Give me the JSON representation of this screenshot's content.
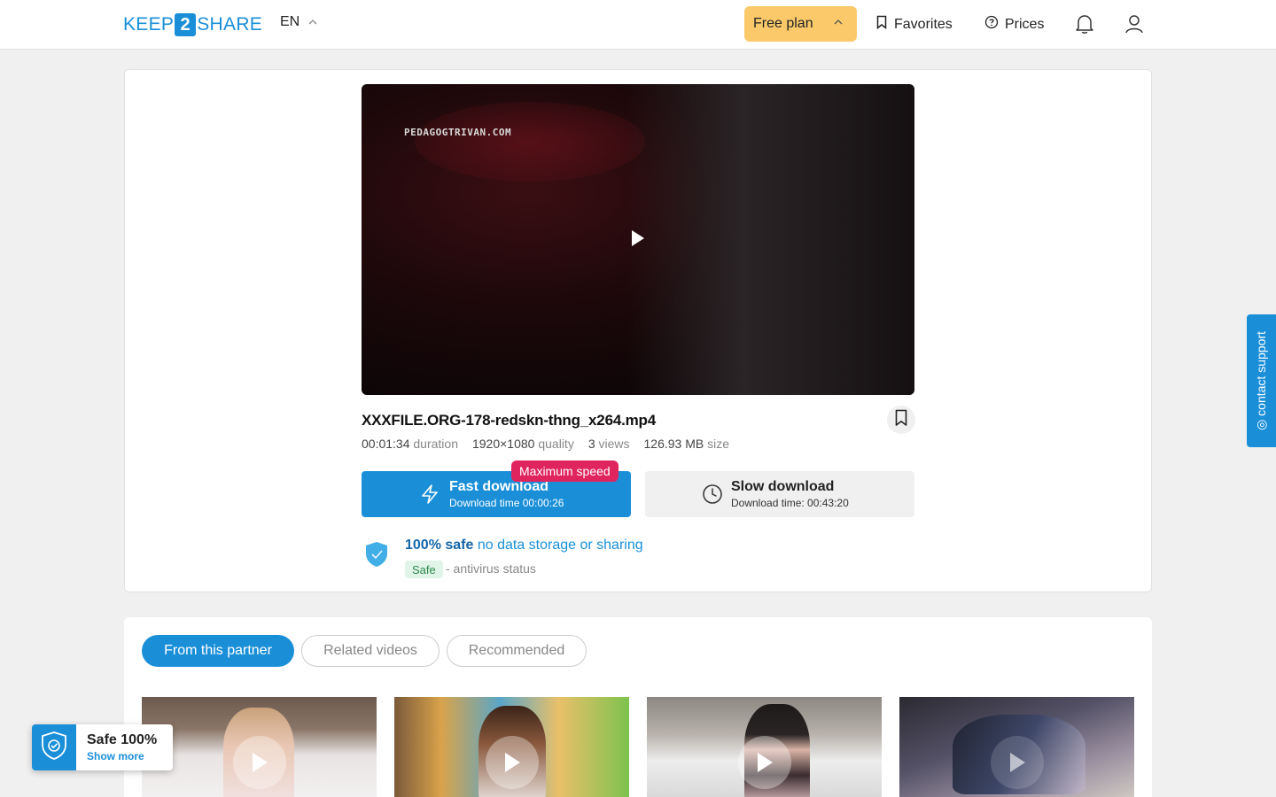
{
  "header": {
    "logo_left": "KEEP",
    "logo_mid": "2",
    "logo_right": "SHARE",
    "language": "EN",
    "plan_label": "Free plan",
    "favorites_label": "Favorites",
    "prices_label": "Prices"
  },
  "video": {
    "watermark": "PEDAGOGTRIVAN.COM",
    "filename": "XXXFILE.ORG-178-redskn-thng_x264.mp4",
    "duration_value": "00:01:34",
    "duration_label": "duration",
    "quality_value": "1920×1080",
    "quality_label": "quality",
    "views_value": "3",
    "views_label": "views",
    "size_value": "126.93 MB",
    "size_label": "size"
  },
  "downloads": {
    "badge": "Maximum speed",
    "fast_title": "Fast download",
    "fast_sub": "Download time 00:00:26",
    "slow_title": "Slow download",
    "slow_sub": "Download time: 00:43:20"
  },
  "safety": {
    "headline_bold": "100% safe",
    "headline_rest": " no data storage or sharing",
    "badge": "Safe",
    "status": "- antivirus status"
  },
  "support": {
    "label": "◎ contact support"
  },
  "tabs": [
    {
      "label": "From this partner"
    },
    {
      "label": "Related videos"
    },
    {
      "label": "Recommended"
    }
  ],
  "widget": {
    "title": "Safe 100%",
    "link": "Show more"
  },
  "colors": {
    "brand": "#1a8fd8",
    "plan": "#fbc96a",
    "badge": "#e0245e",
    "safe_green": "#2c8a4b"
  }
}
